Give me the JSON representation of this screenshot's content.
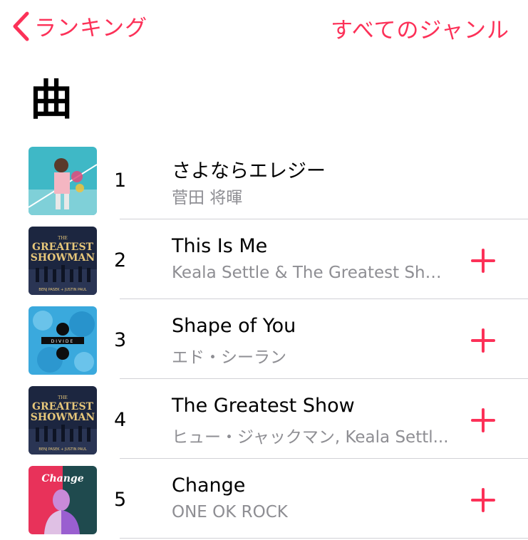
{
  "nav": {
    "back_label": "ランキング",
    "all_genres_label": "すべてのジャンル"
  },
  "page": {
    "title": "曲"
  },
  "songs": [
    {
      "rank": "1",
      "title": "さよならエレジー",
      "artist": "菅田 将暉",
      "has_add": false
    },
    {
      "rank": "2",
      "title": "This Is Me",
      "artist": "Keala Settle & The Greatest Sho...",
      "has_add": true
    },
    {
      "rank": "3",
      "title": "Shape of You",
      "artist": "エド・シーラン",
      "has_add": true
    },
    {
      "rank": "4",
      "title": "The Greatest Show",
      "artist": "ヒュー・ジャックマン, Keala Settl...",
      "has_add": true
    },
    {
      "rank": "5",
      "title": "Change",
      "artist": "ONE OK ROCK",
      "has_add": true
    }
  ],
  "artwork_text": {
    "greatest_line1": "GREATEST",
    "greatest_line2": "SHOWMAN",
    "greatest_the": "THE",
    "greatest_credits": "BENJ PASEK + JUSTIN PAUL",
    "divide": "DIVIDE",
    "change": "Change"
  },
  "colors": {
    "accent": "#fc3158",
    "secondary_text": "#8e8e93",
    "divider": "#d1d1d6"
  },
  "icons": {
    "back": "chevron-left-icon",
    "add": "plus-icon"
  }
}
